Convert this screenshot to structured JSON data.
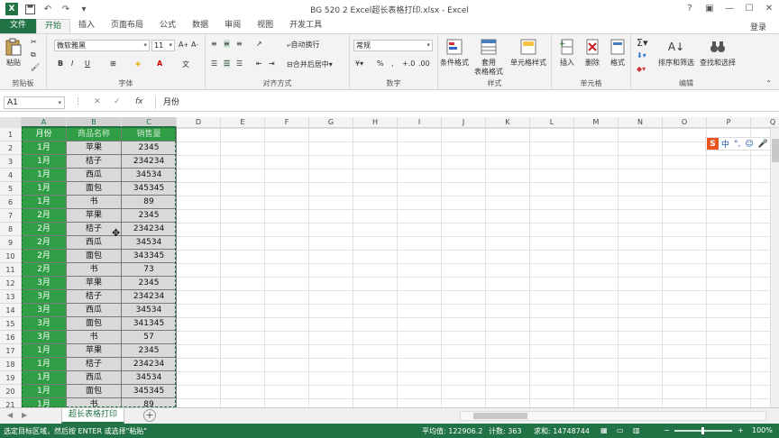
{
  "window": {
    "title": "BG 520 2 Excel超长表格打印.xlsx - Excel",
    "app_icon": "X",
    "login_label": "登录"
  },
  "tabs": [
    {
      "label": "文件"
    },
    {
      "label": "开始"
    },
    {
      "label": "插入"
    },
    {
      "label": "页面布局"
    },
    {
      "label": "公式"
    },
    {
      "label": "数据"
    },
    {
      "label": "审阅"
    },
    {
      "label": "视图"
    },
    {
      "label": "开发工具"
    }
  ],
  "ribbon": {
    "clipboard": {
      "paste": "粘贴",
      "group": "剪贴板"
    },
    "font": {
      "name": "微软雅黑",
      "size": "11",
      "group": "字体"
    },
    "alignment": {
      "wrap": "自动换行",
      "merge": "合并后居中",
      "group": "对齐方式"
    },
    "number": {
      "format": "常规",
      "group": "数字"
    },
    "styles": {
      "conditional": "条件格式",
      "table1": "套用",
      "table2": "表格格式",
      "cell_styles": "单元格样式",
      "group": "样式"
    },
    "cells": {
      "insert": "插入",
      "delete": "删除",
      "format": "格式",
      "group": "单元格"
    },
    "editing": {
      "sort": "排序和筛选",
      "find": "查找和选择",
      "group": "编辑"
    }
  },
  "formula_bar": {
    "name_box": "A1",
    "fx": "fx",
    "content": "月份"
  },
  "columns": [
    "A",
    "B",
    "C",
    "D",
    "E",
    "F",
    "G",
    "H",
    "I",
    "J",
    "K",
    "L",
    "M",
    "N",
    "O",
    "P",
    "Q"
  ],
  "header_row": [
    "月份",
    "商品名称",
    "销售量"
  ],
  "rows": [
    [
      "1月",
      "苹果",
      "2345"
    ],
    [
      "1月",
      "桔子",
      "234234"
    ],
    [
      "1月",
      "西瓜",
      "34534"
    ],
    [
      "1月",
      "面包",
      "345345"
    ],
    [
      "1月",
      "书",
      "89"
    ],
    [
      "2月",
      "苹果",
      "2345"
    ],
    [
      "2月",
      "桔子",
      "234234"
    ],
    [
      "2月",
      "西瓜",
      "34534"
    ],
    [
      "2月",
      "面包",
      "343345"
    ],
    [
      "2月",
      "书",
      "73"
    ],
    [
      "3月",
      "苹果",
      "2345"
    ],
    [
      "3月",
      "桔子",
      "234234"
    ],
    [
      "3月",
      "西瓜",
      "34534"
    ],
    [
      "3月",
      "面包",
      "341345"
    ],
    [
      "3月",
      "书",
      "57"
    ],
    [
      "1月",
      "苹果",
      "2345"
    ],
    [
      "1月",
      "桔子",
      "234234"
    ],
    [
      "1月",
      "西瓜",
      "34534"
    ],
    [
      "1月",
      "面包",
      "345345"
    ],
    [
      "1月",
      "书",
      "89"
    ]
  ],
  "row_numbers": [
    "1",
    "2",
    "3",
    "4",
    "5",
    "6",
    "7",
    "8",
    "9",
    "10",
    "11",
    "12",
    "13",
    "14",
    "15",
    "16",
    "17",
    "18",
    "19",
    "20",
    "21"
  ],
  "ime": {
    "logo": "S",
    "lang": "中"
  },
  "sheet": {
    "tab_label": "超长表格打印",
    "add": "+"
  },
  "status": {
    "message": "选定目标区域，然后按 ENTER 或选择\"粘贴\"",
    "average": "平均值: 122906.2",
    "count": "计数: 363",
    "sum": "求和: 14748744",
    "zoom": "100%"
  },
  "colors": {
    "accent": "#217346",
    "highlight_green": "#2f9e44",
    "gray_cell": "#d9d9d9"
  }
}
